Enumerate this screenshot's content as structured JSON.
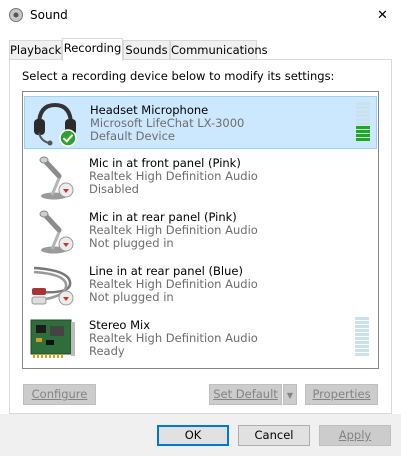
{
  "window": {
    "title": "Sound",
    "close_glyph": "✕"
  },
  "tabs": [
    {
      "label": "Playback",
      "active": false
    },
    {
      "label": "Recording",
      "active": true
    },
    {
      "label": "Sounds",
      "active": false
    },
    {
      "label": "Communications",
      "active": false
    }
  ],
  "instruction": "Select a recording device below to modify its settings:",
  "devices": [
    {
      "name": "Headset Microphone",
      "driver": "Microsoft LifeChat LX-3000",
      "status": "Default Device",
      "icon": "headset-icon",
      "badge": "check-badge-icon",
      "selected": true,
      "level_segments_lit": 4
    },
    {
      "name": "Mic in at front panel (Pink)",
      "driver": "Realtek High Definition Audio",
      "status": "Disabled",
      "icon": "microphone-icon",
      "badge": "down-arrow-badge-icon",
      "selected": false
    },
    {
      "name": "Mic in at rear panel (Pink)",
      "driver": "Realtek High Definition Audio",
      "status": "Not plugged in",
      "icon": "microphone-icon",
      "badge": "down-arrow-badge-icon",
      "selected": false
    },
    {
      "name": "Line in at rear panel (Blue)",
      "driver": "Realtek High Definition Audio",
      "status": "Not plugged in",
      "icon": "rca-cable-icon",
      "badge": "down-arrow-badge-icon",
      "selected": false
    },
    {
      "name": "Stereo Mix",
      "driver": "Realtek High Definition Audio",
      "status": "Ready",
      "icon": "sound-card-icon",
      "badge": "",
      "selected": false,
      "level_segments_lit": 0
    }
  ],
  "buttons": {
    "configure": "Configure",
    "set_default": "Set Default",
    "properties": "Properties",
    "ok": "OK",
    "cancel": "Cancel",
    "apply": "Apply"
  },
  "colors": {
    "selection_bg": "#cce8ff",
    "meter_lit": "#1fa91f",
    "meter_unlit": "#c9e2ec",
    "accent": "#0078d7"
  }
}
